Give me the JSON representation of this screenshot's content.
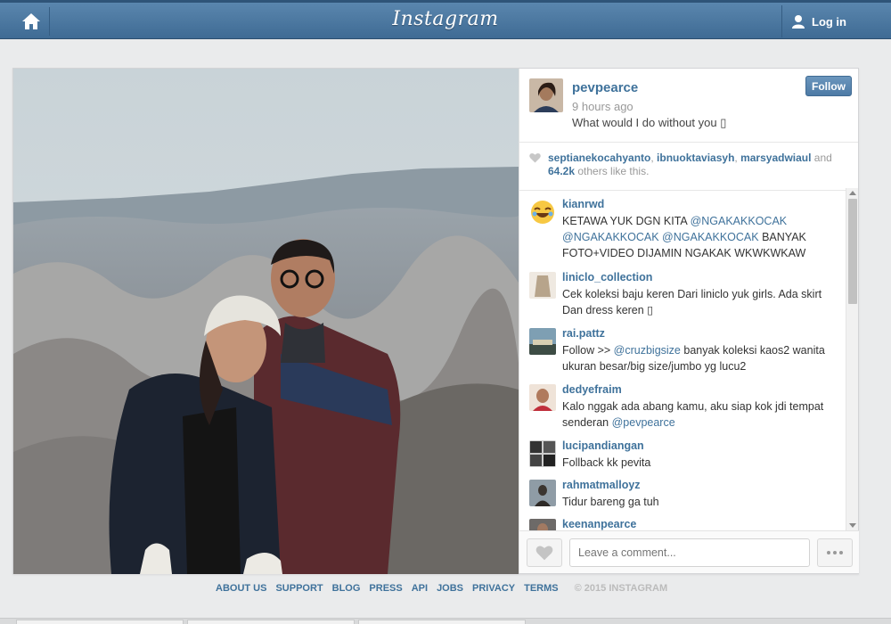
{
  "topbar": {
    "logo": "Instagram",
    "login_label": "Log in"
  },
  "post": {
    "username": "pevpearce",
    "time": "9 hours ago",
    "caption": "What would I do without you ▯",
    "follow_label": "Follow"
  },
  "likes": {
    "users": [
      "septianekocahyanto",
      "ibnuoktaviasyh",
      "marsyadwiaul"
    ],
    "sep1": ", ",
    "sep2": ", ",
    "and": " and",
    "count": "64.2k",
    "suffix": " others like this."
  },
  "comments": [
    {
      "user": "kianrwd",
      "parts": [
        {
          "t": "KETAWA YUK DGN KITA "
        },
        {
          "t": "@NGAKAKKOCAK",
          "m": true
        },
        {
          "t": " "
        },
        {
          "t": "@NGAKAKKOCAK",
          "m": true
        },
        {
          "t": " "
        },
        {
          "t": "@NGAKAKKOCAK",
          "m": true
        },
        {
          "t": " BANYAK FOTO+VIDEO DIJAMIN NGAKAK WKWKWKAW"
        }
      ]
    },
    {
      "user": "liniclo_collection",
      "parts": [
        {
          "t": "Cek koleksi baju keren Dari liniclo yuk girls. Ada skirt Dan dress keren ▯"
        }
      ]
    },
    {
      "user": "rai.pattz",
      "parts": [
        {
          "t": "Follow >> "
        },
        {
          "t": "@cruzbigsize",
          "m": true
        },
        {
          "t": " banyak koleksi kaos2 wanita ukuran besar/big size/jumbo yg lucu2"
        }
      ]
    },
    {
      "user": "dedyefraim",
      "parts": [
        {
          "t": "Kalo nggak ada abang kamu, aku siap kok jdi tempat senderan "
        },
        {
          "t": "@pevpearce",
          "m": true
        }
      ]
    },
    {
      "user": "lucipandiangan",
      "parts": [
        {
          "t": "Follback kk pevita"
        }
      ]
    },
    {
      "user": "rahmatmalloyz",
      "parts": [
        {
          "t": "Tidur bareng ga tuh"
        }
      ]
    },
    {
      "user": "keenanpearce",
      "parts": []
    }
  ],
  "comment_box": {
    "placeholder": "Leave a comment..."
  },
  "footer": {
    "links": [
      "ABOUT US",
      "SUPPORT",
      "BLOG",
      "PRESS",
      "API",
      "JOBS",
      "PRIVACY",
      "TERMS"
    ],
    "copyright": "© 2015 INSTAGRAM"
  },
  "colors": {
    "link": "#3f729b",
    "topbar": "#4a77a0"
  },
  "icons": [
    "home-icon",
    "user-icon",
    "heart-icon",
    "more-icon"
  ]
}
